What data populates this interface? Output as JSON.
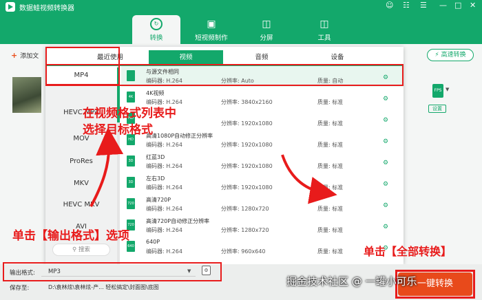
{
  "app": {
    "title": "数据蛙视频转换器"
  },
  "nav": {
    "tabs": [
      {
        "label": "转换",
        "icon": "convert-icon"
      },
      {
        "label": "短视频制作",
        "icon": "video-icon"
      },
      {
        "label": "分屏",
        "icon": "split-icon"
      },
      {
        "label": "工具",
        "icon": "toolbox-icon"
      }
    ]
  },
  "toolbar": {
    "add_file_label": "添加文",
    "fast_convert_label": "高速转换"
  },
  "file": {
    "format_badge": "FPS",
    "settings_label": "设置"
  },
  "panel": {
    "tabs": [
      "最近使用",
      "视频",
      "音频",
      "设备"
    ],
    "active_tab": "视频",
    "formats": [
      "MP4",
      "HEVC MP4",
      "MOV",
      "ProRes",
      "MKV",
      "HEVC MKV",
      "AVI"
    ],
    "selected_format": "MP4",
    "search_placeholder": "搜索",
    "enc_label": "编码器:",
    "res_label": "分辨率:",
    "q_label": "质量:",
    "presets": [
      {
        "name": "与源文件相同",
        "icon_text": "",
        "encoder": "H.264",
        "resolution": "Auto",
        "quality": "自动"
      },
      {
        "name": "4K视频",
        "icon_text": "4K",
        "encoder": "H.264",
        "resolution": "3840x2160",
        "quality": "标准"
      },
      {
        "name": "",
        "icon_text": "HD",
        "encoder": "",
        "resolution": "1920x1080",
        "quality": "标准"
      },
      {
        "name": "高清1080P自动修正分辨率",
        "icon_text": "HD",
        "encoder": "H.264",
        "resolution": "1920x1080",
        "quality": "标准"
      },
      {
        "name": "红蓝3D",
        "icon_text": "3D",
        "encoder": "H.264",
        "resolution": "1920x1080",
        "quality": "标准"
      },
      {
        "name": "左右3D",
        "icon_text": "3D",
        "encoder": "H.264",
        "resolution": "1920x1080",
        "quality": "标准"
      },
      {
        "name": "高清720P",
        "icon_text": "720",
        "encoder": "H.264",
        "resolution": "1280x720",
        "quality": "标准"
      },
      {
        "name": "高清720P自动修正分辨率",
        "icon_text": "720",
        "encoder": "H.264",
        "resolution": "1280x720",
        "quality": "标准"
      },
      {
        "name": "640P",
        "icon_text": "640",
        "encoder": "H.264",
        "resolution": "960x640",
        "quality": "标准"
      }
    ]
  },
  "bottom": {
    "output_label": "输出格式:",
    "output_value": "MP3",
    "save_label": "保存至:",
    "save_path": "D:\\袁林炫\\袁林炫-产... 轻松搞定\\封面图\\底图",
    "convert_all_label": "一键转换"
  },
  "annotations": {
    "step1_line1": "在视频格式列表中",
    "step1_line2": "选择目标格式",
    "step2": "单击【输出格式】选项",
    "step3": "单击【全部转换】"
  },
  "watermark": "掘金技术社区 @ 一罐小可乐",
  "colors": {
    "accent": "#13a86b",
    "highlight": "#e81b1b",
    "convert": "#e84a1b"
  }
}
